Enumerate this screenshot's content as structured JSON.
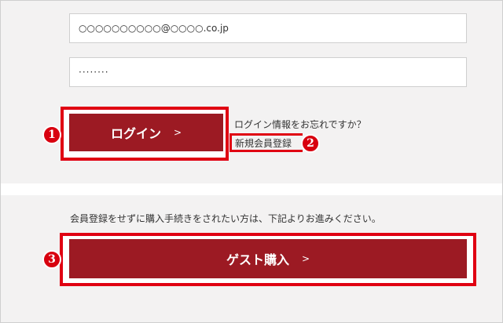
{
  "form": {
    "email_value": "○○○○○○○○○○@○○○○.co.jp",
    "password_value": "········"
  },
  "login": {
    "label": "ログイン",
    "arrow": ">",
    "badge": "1"
  },
  "help": {
    "forgot_text": "ログイン情報をお忘れですか？",
    "register_label": "新規会員登録",
    "badge": "2"
  },
  "guest": {
    "note": "会員登録をせずに購入手続きをされたい方は、下記よりお進みください。",
    "label": "ゲスト購入",
    "arrow": ">",
    "badge": "3"
  },
  "colors": {
    "button": "#9c1a23",
    "highlight": "#e00012",
    "panel": "#f3f2f2"
  }
}
